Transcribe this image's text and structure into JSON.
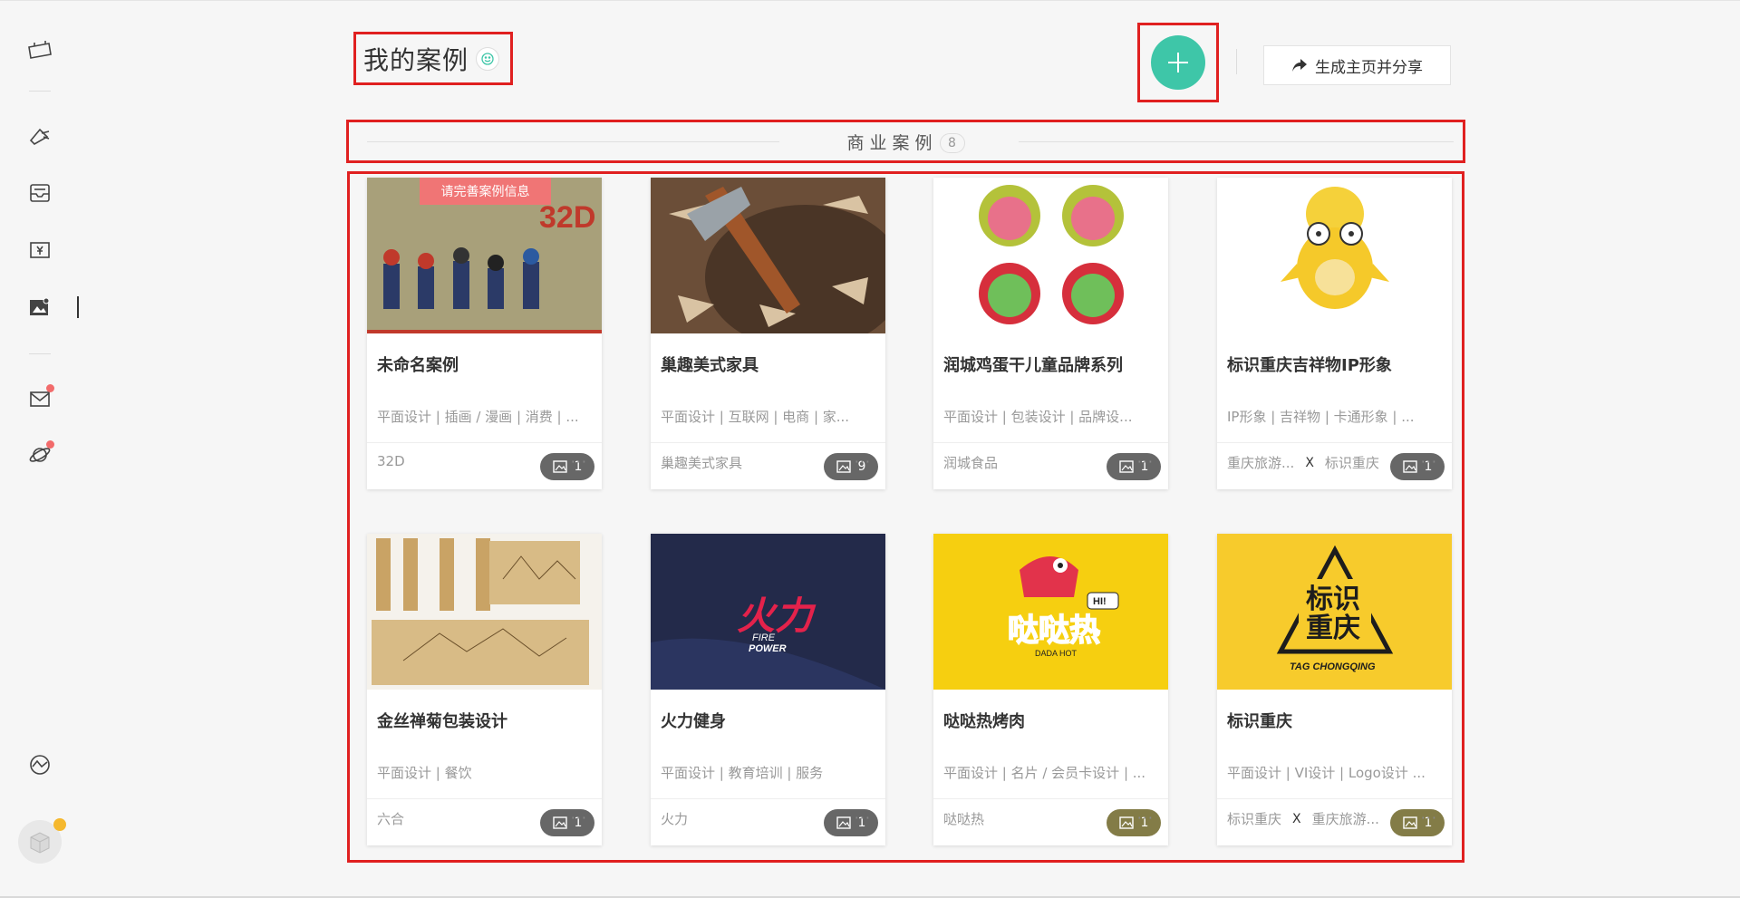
{
  "sidebar": {
    "icons": [
      "logo-icon",
      "megaphone-icon",
      "inbox-icon",
      "payment-icon",
      "gallery-icon",
      "mail-icon",
      "planet-icon",
      "discover-icon"
    ],
    "avatar": "avatar"
  },
  "header": {
    "title": "我的案例",
    "share_label": "生成主页并分享"
  },
  "section": {
    "title": "商业案例",
    "count": "8"
  },
  "colors": {
    "accent": "#3ec6a8",
    "highlight": "#e02020",
    "ribbon": "#f07575",
    "notify_dot": "#f26b6b"
  },
  "cards": [
    {
      "title": "未命名案例",
      "tags": "平面设计 | 插画 / 漫画 | 消费 | ...",
      "brand": "32D",
      "partner": "",
      "image_count": "1",
      "ribbon": "请完善案例信息",
      "more": "···"
    },
    {
      "title": "巢趣美式家具",
      "tags": "平面设计 | 互联网 | 电商 | 家...",
      "brand": "巢趣美式家具",
      "partner": "",
      "image_count": "9",
      "ribbon": "",
      "more": "···"
    },
    {
      "title": "润城鸡蛋干儿童品牌系列",
      "tags": "平面设计 | 包装设计 | 品牌设...",
      "brand": "润城食品",
      "partner": "",
      "image_count": "1",
      "ribbon": "",
      "more": "···"
    },
    {
      "title": "标识重庆吉祥物IP形象",
      "tags": "IP形象 | 吉祥物 | 卡通形象 | ...",
      "brand": "重庆旅游...",
      "partner": "标识重庆",
      "x": "X",
      "image_count": "1",
      "ribbon": "",
      "more": "···"
    },
    {
      "title": "金丝禅菊包装设计",
      "tags": "平面设计 | 餐饮",
      "brand": "六合",
      "partner": "",
      "image_count": "1",
      "ribbon": "",
      "more": "···"
    },
    {
      "title": "火力健身",
      "tags": "平面设计 | 教育培训 | 服务",
      "brand": "火力",
      "partner": "",
      "image_count": "1",
      "ribbon": "",
      "more": "···"
    },
    {
      "title": "哒哒热烤肉",
      "tags": "平面设计 | 名片 / 会员卡设计 | ...",
      "brand": "哒哒热",
      "partner": "",
      "image_count": "1",
      "ribbon": "",
      "more": "···"
    },
    {
      "title": "标识重庆",
      "tags": "平面设计 | VI设计 | Logo设计 ...",
      "brand": "标识重庆",
      "partner": "重庆旅游...",
      "x": "X",
      "image_count": "1",
      "ribbon": "",
      "more": "···"
    }
  ],
  "image_text": {
    "card1_logo": "32D",
    "card6_line1": "火力",
    "card6_line2": "FIRE",
    "card6_line3": "POWER",
    "card7_line1": "哒哒热",
    "card7_line2": "DADA HOT",
    "card7_hi": "HI!",
    "card8_line1": "标识",
    "card8_line2": "重庆",
    "card8_line3": "TAG CHONGQING"
  }
}
